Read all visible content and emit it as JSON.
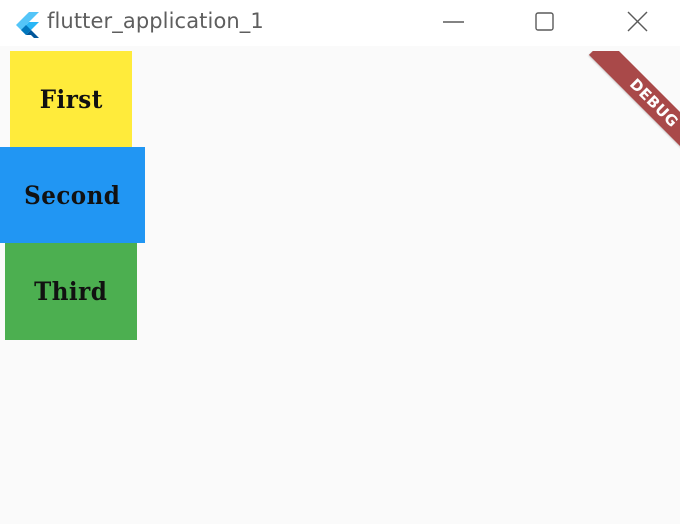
{
  "window": {
    "title": "flutter_application_1",
    "icon": "flutter-logo-icon",
    "controls": [
      "minimize-icon",
      "maximize-icon",
      "close-icon"
    ]
  },
  "boxes": {
    "first": {
      "label": "First",
      "color": "#ffeb3b"
    },
    "second": {
      "label": "Second",
      "color": "#2196f3"
    },
    "third": {
      "label": "Third",
      "color": "#4caf50"
    }
  },
  "debug_banner": {
    "label": "DEBUG",
    "color": "#a33b3b"
  },
  "colors": {
    "titlebar_bg": "#ffffff",
    "content_bg": "#fafafa",
    "title_text": "#5e5e5e"
  }
}
